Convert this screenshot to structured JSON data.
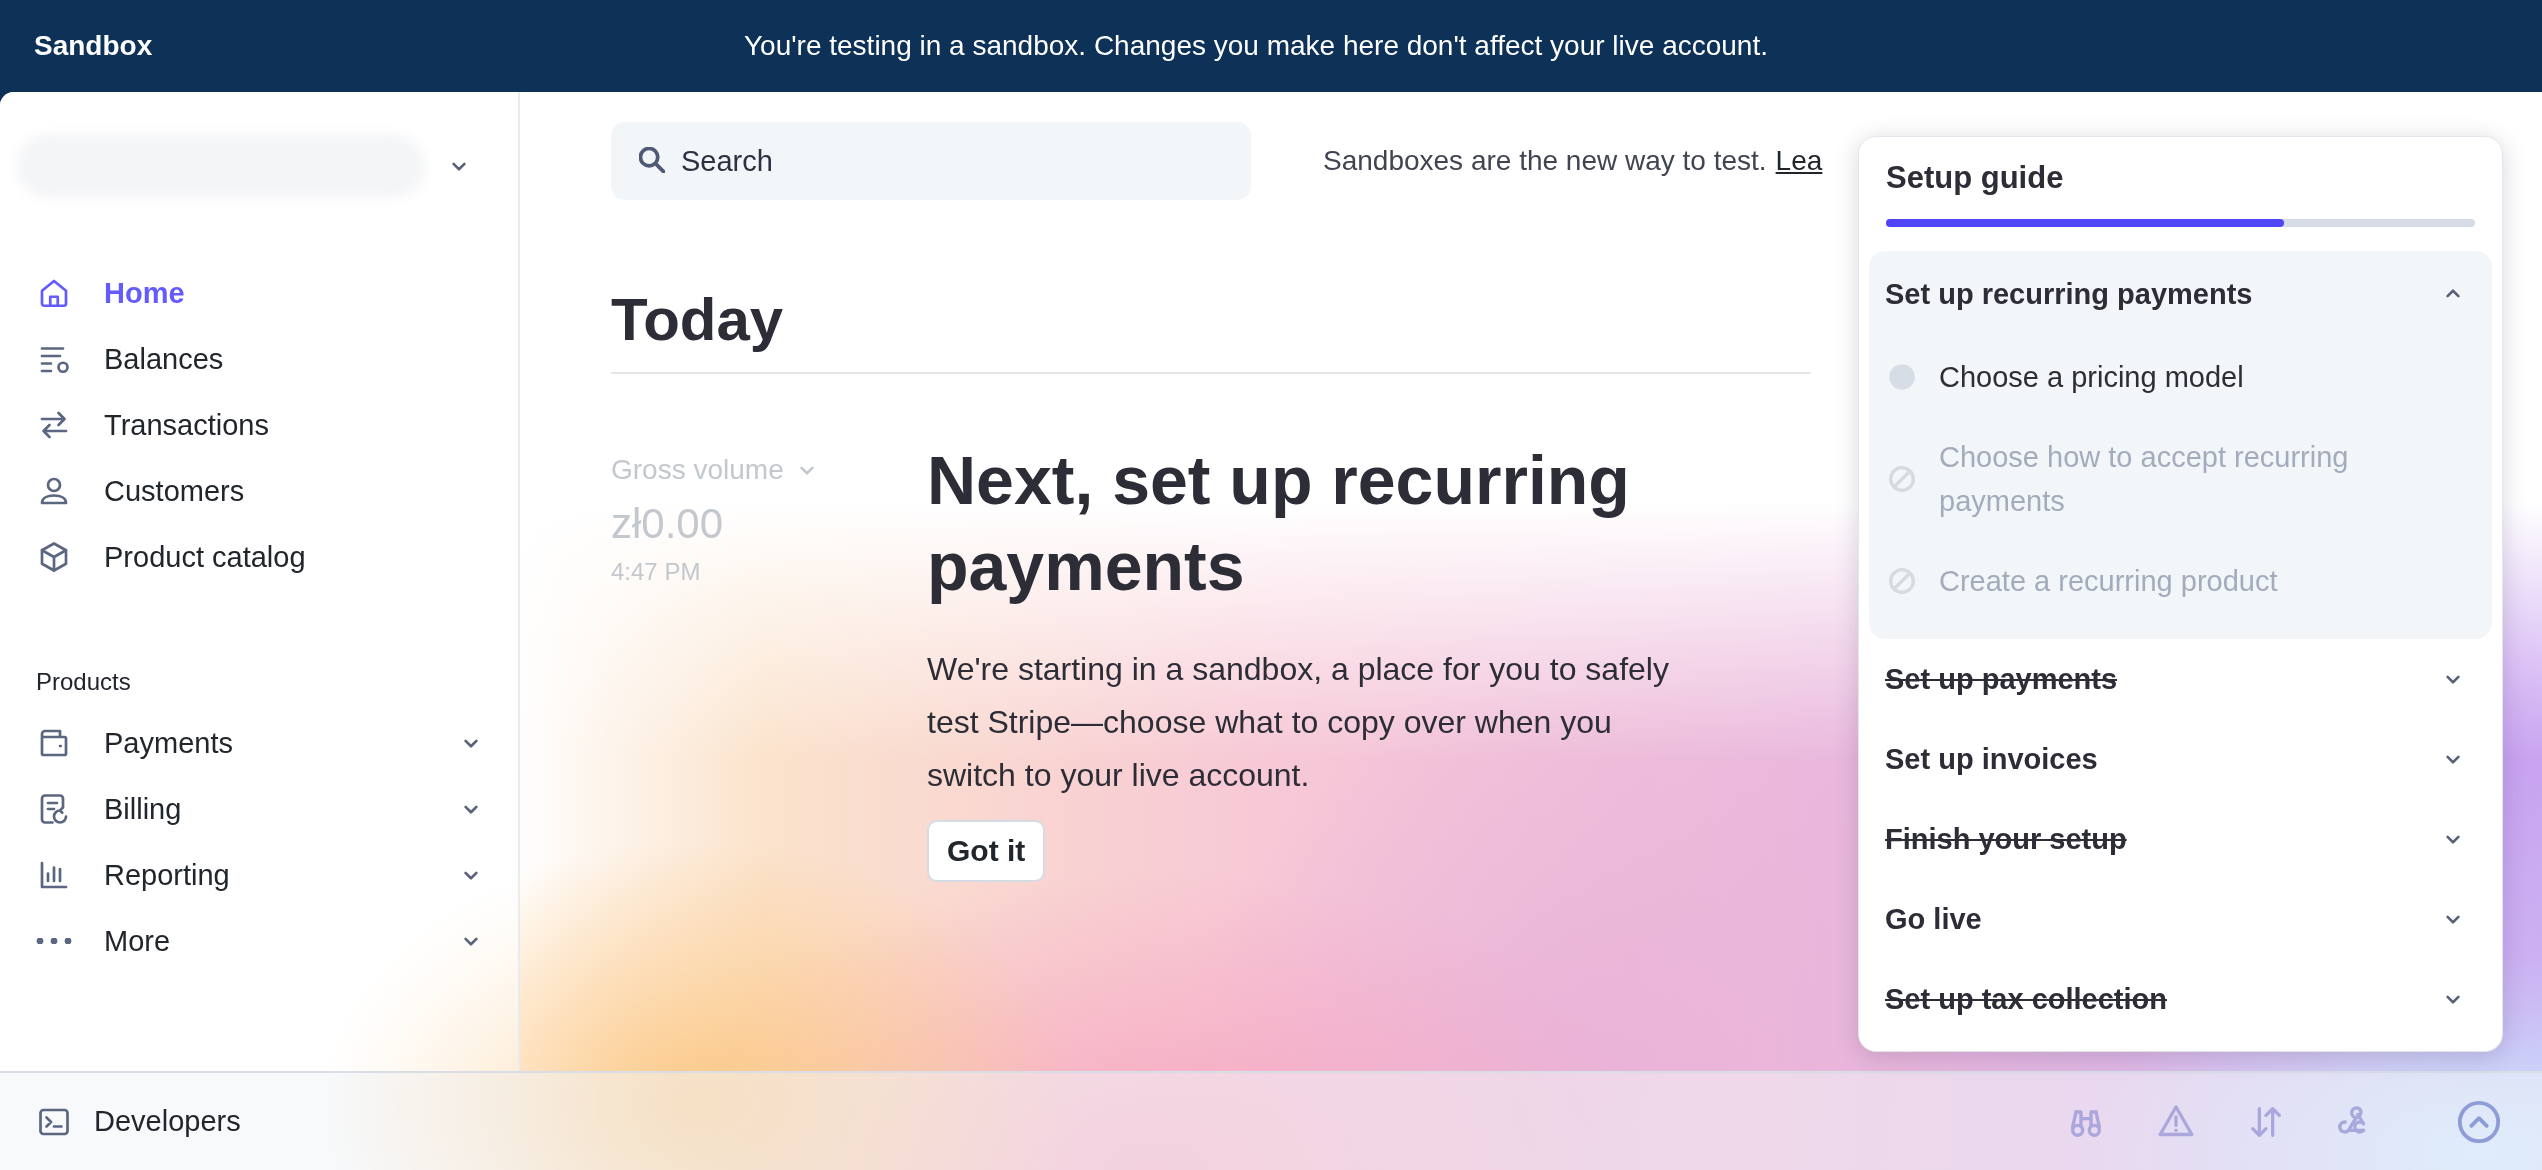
{
  "banner": {
    "label": "Sandbox",
    "message": "You're testing in a sandbox. Changes you make here don't affect your live account."
  },
  "sidebar": {
    "nav": [
      {
        "label": "Home",
        "selected": true
      },
      {
        "label": "Balances",
        "selected": false
      },
      {
        "label": "Transactions",
        "selected": false
      },
      {
        "label": "Customers",
        "selected": false
      },
      {
        "label": "Product catalog",
        "selected": false
      }
    ],
    "section_label": "Products",
    "products": [
      {
        "label": "Payments"
      },
      {
        "label": "Billing"
      },
      {
        "label": "Reporting"
      },
      {
        "label": "More"
      }
    ]
  },
  "search": {
    "placeholder": "Search"
  },
  "notice": {
    "text": "Sandboxes are the new way to test.",
    "link": "Lea"
  },
  "page_title": "Today",
  "metrics": [
    {
      "label": "Gross volume",
      "value": "zł0.00",
      "time": "4:47 PM"
    }
  ],
  "onboarding": {
    "title": "Next, set up recurring payments",
    "body": "We're starting in a sandbox, a place for you to safely test Stripe—choose what to copy over when you switch to your live account.",
    "button": "Got it"
  },
  "setup_guide": {
    "title": "Setup guide",
    "level": 0.675,
    "sections": [
      {
        "title": "Set up recurring payments",
        "expanded": true,
        "completed": false,
        "steps": [
          {
            "label": "Choose a pricing model",
            "disabled": false
          },
          {
            "label": "Choose how to accept recurring payments",
            "disabled": true
          },
          {
            "label": "Create a recurring product",
            "disabled": true
          }
        ]
      },
      {
        "title": "Set up payments",
        "expanded": false,
        "completed": true
      },
      {
        "title": "Set up invoices",
        "expanded": false,
        "completed": false
      },
      {
        "title": "Finish your setup",
        "expanded": false,
        "completed": true
      },
      {
        "title": "Go live",
        "expanded": false,
        "completed": false
      },
      {
        "title": "Set up tax collection",
        "expanded": false,
        "completed": true
      }
    ]
  },
  "developers": {
    "label": "Developers"
  }
}
